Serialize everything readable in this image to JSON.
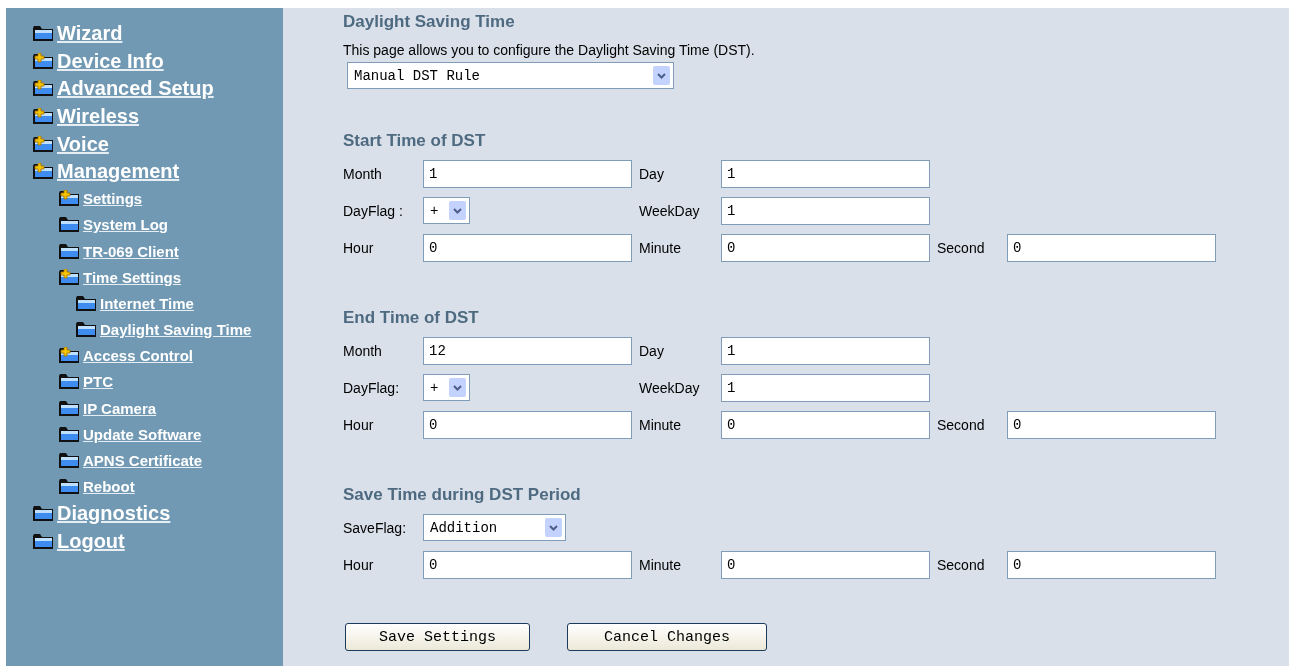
{
  "sidebar": {
    "items": [
      {
        "label": "Wizard",
        "expandable": false
      },
      {
        "label": "Device Info",
        "expandable": true
      },
      {
        "label": "Advanced Setup",
        "expandable": true
      },
      {
        "label": "Wireless",
        "expandable": true
      },
      {
        "label": "Voice",
        "expandable": true
      },
      {
        "label": "Management",
        "expandable": true,
        "children": [
          {
            "label": "Settings",
            "expandable": true
          },
          {
            "label": "System Log",
            "expandable": false
          },
          {
            "label": "TR-069 Client",
            "expandable": false
          },
          {
            "label": "Time Settings",
            "expandable": true,
            "children": [
              {
                "label": "Internet Time",
                "expandable": false
              },
              {
                "label": "Daylight Saving Time",
                "expandable": false
              }
            ]
          },
          {
            "label": "Access Control",
            "expandable": true
          },
          {
            "label": "PTC",
            "expandable": false
          },
          {
            "label": "IP Camera",
            "expandable": false
          },
          {
            "label": "Update Software",
            "expandable": false
          },
          {
            "label": "APNS Certificate",
            "expandable": false
          },
          {
            "label": "Reboot",
            "expandable": false
          }
        ]
      },
      {
        "label": "Diagnostics",
        "expandable": false
      },
      {
        "label": "Logout",
        "expandable": false
      }
    ]
  },
  "page": {
    "title": "Daylight Saving Time",
    "description": "This page allows you to configure the Daylight Saving Time (DST).",
    "rule_select": "Manual DST Rule"
  },
  "sections": [
    {
      "title": "Start Time of DST",
      "rows": [
        [
          {
            "label": "Month",
            "kind": "text",
            "value": "1"
          },
          {
            "label": "Day",
            "kind": "text",
            "value": "1"
          }
        ],
        [
          {
            "label": "DayFlag :",
            "kind": "select",
            "value": "+"
          },
          {
            "label": "WeekDay",
            "kind": "text",
            "value": "1"
          }
        ],
        [
          {
            "label": "Hour",
            "kind": "text",
            "value": "0"
          },
          {
            "label": "Minute",
            "kind": "text",
            "value": "0"
          },
          {
            "label": "Second",
            "kind": "text",
            "value": "0"
          }
        ]
      ]
    },
    {
      "title": "End Time of DST",
      "rows": [
        [
          {
            "label": "Month",
            "kind": "text",
            "value": "12"
          },
          {
            "label": "Day",
            "kind": "text",
            "value": "1"
          }
        ],
        [
          {
            "label": "DayFlag:",
            "kind": "select",
            "value": "+"
          },
          {
            "label": "WeekDay",
            "kind": "text",
            "value": "1"
          }
        ],
        [
          {
            "label": "Hour",
            "kind": "text",
            "value": "0"
          },
          {
            "label": "Minute",
            "kind": "text",
            "value": "0"
          },
          {
            "label": "Second",
            "kind": "text",
            "value": "0"
          }
        ]
      ]
    },
    {
      "title": "Save Time during DST Period",
      "rows": [
        [
          {
            "label": "SaveFlag:",
            "kind": "wideselect",
            "value": "Addition"
          }
        ],
        [
          {
            "label": "Hour",
            "kind": "text",
            "value": "0"
          },
          {
            "label": "Minute",
            "kind": "text",
            "value": "0"
          },
          {
            "label": "Second",
            "kind": "text",
            "value": "0"
          }
        ]
      ]
    }
  ],
  "buttons": [
    "Save Settings",
    "Cancel Changes"
  ]
}
